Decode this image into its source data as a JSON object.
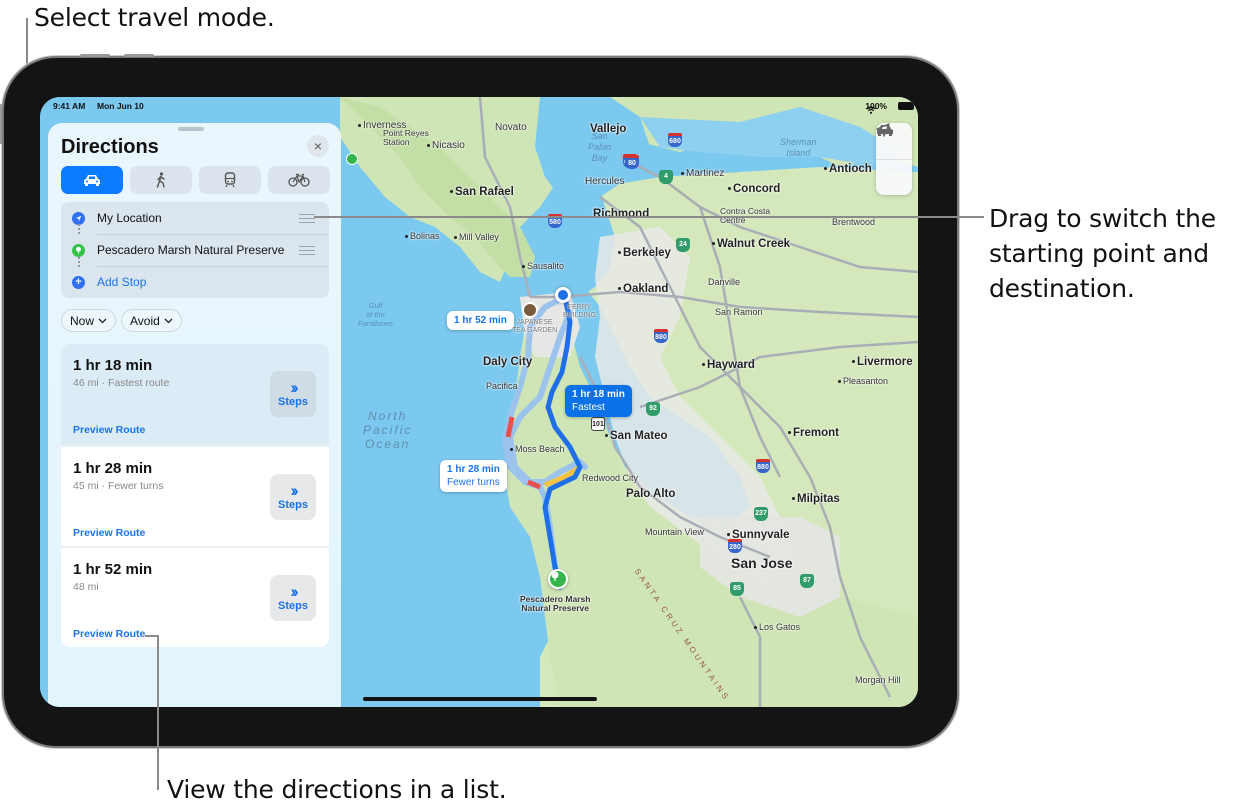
{
  "callouts": {
    "travel_mode": "Select travel mode.",
    "drag_switch": [
      "Drag to switch the",
      "starting point and",
      "destination."
    ],
    "view_list": "View the directions in a list."
  },
  "status_bar": {
    "time": "9:41 AM",
    "date": "Mon Jun 10",
    "battery": "100%"
  },
  "panel": {
    "title": "Directions",
    "close_icon": "×",
    "travel_modes": [
      {
        "name": "drive",
        "icon": "car-icon",
        "active": true
      },
      {
        "name": "walk",
        "icon": "walk-icon",
        "active": false
      },
      {
        "name": "transit",
        "icon": "train-icon",
        "active": false
      },
      {
        "name": "cycle",
        "icon": "bicycle-icon",
        "active": false
      }
    ],
    "stops": [
      {
        "label": "My Location",
        "icon": "location-arrow-icon",
        "color": "#2f6ff0"
      },
      {
        "label": "Pescadero Marsh Natural Preserve",
        "icon": "tree-icon",
        "color": "#34c24a"
      },
      {
        "label": "Add Stop",
        "icon": "plus-icon",
        "color": "#2f6ff0"
      }
    ],
    "filters": [
      {
        "label": "Now"
      },
      {
        "label": "Avoid"
      }
    ],
    "routes": [
      {
        "time": "1 hr 18 min",
        "detail": "46 mi · Fastest route",
        "steps_label": "Steps",
        "preview_label": "Preview Route",
        "selected": true
      },
      {
        "time": "1 hr 28 min",
        "detail": "45 mi · Fewer turns",
        "steps_label": "Steps",
        "preview_label": "Preview Route",
        "selected": false
      },
      {
        "time": "1 hr 52 min",
        "detail": "48 mi",
        "steps_label": "Steps",
        "preview_label": "Preview Route",
        "selected": false
      }
    ]
  },
  "map": {
    "route_bubbles": [
      {
        "time": "1 hr 52 min",
        "sub": ""
      },
      {
        "time": "1 hr 18 min",
        "sub": "Fastest"
      },
      {
        "time": "1 hr 28 min",
        "sub": "Fewer turns"
      }
    ],
    "destination_label": [
      "Pescadero Marsh",
      "Natural Preserve"
    ],
    "labels": {
      "inverness": "Inverness",
      "point_reyes": [
        "Point Reyes",
        "Station"
      ],
      "nicasio": "Nicasio",
      "novato": "Novato",
      "vallejo": "Vallejo",
      "san_pablo_bay": [
        "San",
        "Pablo",
        "Bay"
      ],
      "grizzly_island": "Island",
      "sherman_island": [
        "Sherman",
        "Island"
      ],
      "hercules": "Hercules",
      "martinez": "Martinez",
      "concord": "Concord",
      "antioch": "Antioch",
      "san_rafael": "San Rafael",
      "richmond": "Richmond",
      "contra_costa": [
        "Contra Costa",
        "Centre"
      ],
      "brentwood": "Brentwood",
      "bolinas": "Bolinas",
      "mill_valley": "Mill Valley",
      "berkeley": "Berkeley",
      "walnut_creek": "Walnut Creek",
      "sausalito": "Sausalito",
      "oakland": "Oakland",
      "danville": "Danville",
      "gulf": [
        "Gulf",
        "of the",
        "Farallones"
      ],
      "japanese_garden": [
        "JAPANESE",
        "TEA GARDEN"
      ],
      "ferry_building": [
        "FERRY",
        "BUILDING"
      ],
      "san_ramon": "San Ramon",
      "daly_city": "Daly City",
      "hayward": "Hayward",
      "livermore": "Livermore",
      "pacifica": "Pacifica",
      "pleasanton": "Pleasanton",
      "north_pacific": [
        "North",
        "Pacific",
        "Ocean"
      ],
      "san_mateo": "San Mateo",
      "fremont": "Fremont",
      "moss_beach": "Moss Beach",
      "redwood_city": "Redwood City",
      "palo_alto": "Palo Alto",
      "milpitas": "Milpitas",
      "mountain_view": "Mountain View",
      "sunnyvale": "Sunnyvale",
      "san_jose": "San Jose",
      "los_gatos": "Los Gatos",
      "santa_cruz_mtns": "SANTA CRUZ MOUNTAINS",
      "morgan_hill": "Morgan Hill"
    },
    "shields": {
      "i580": "580",
      "i680": "680",
      "i80": "80",
      "sr4": "4",
      "sr24": "24",
      "i880a": "880",
      "sr92": "92",
      "us101": "101",
      "i880b": "880",
      "sr237": "237",
      "i280": "280",
      "sr85": "85",
      "sr87": "87"
    }
  }
}
